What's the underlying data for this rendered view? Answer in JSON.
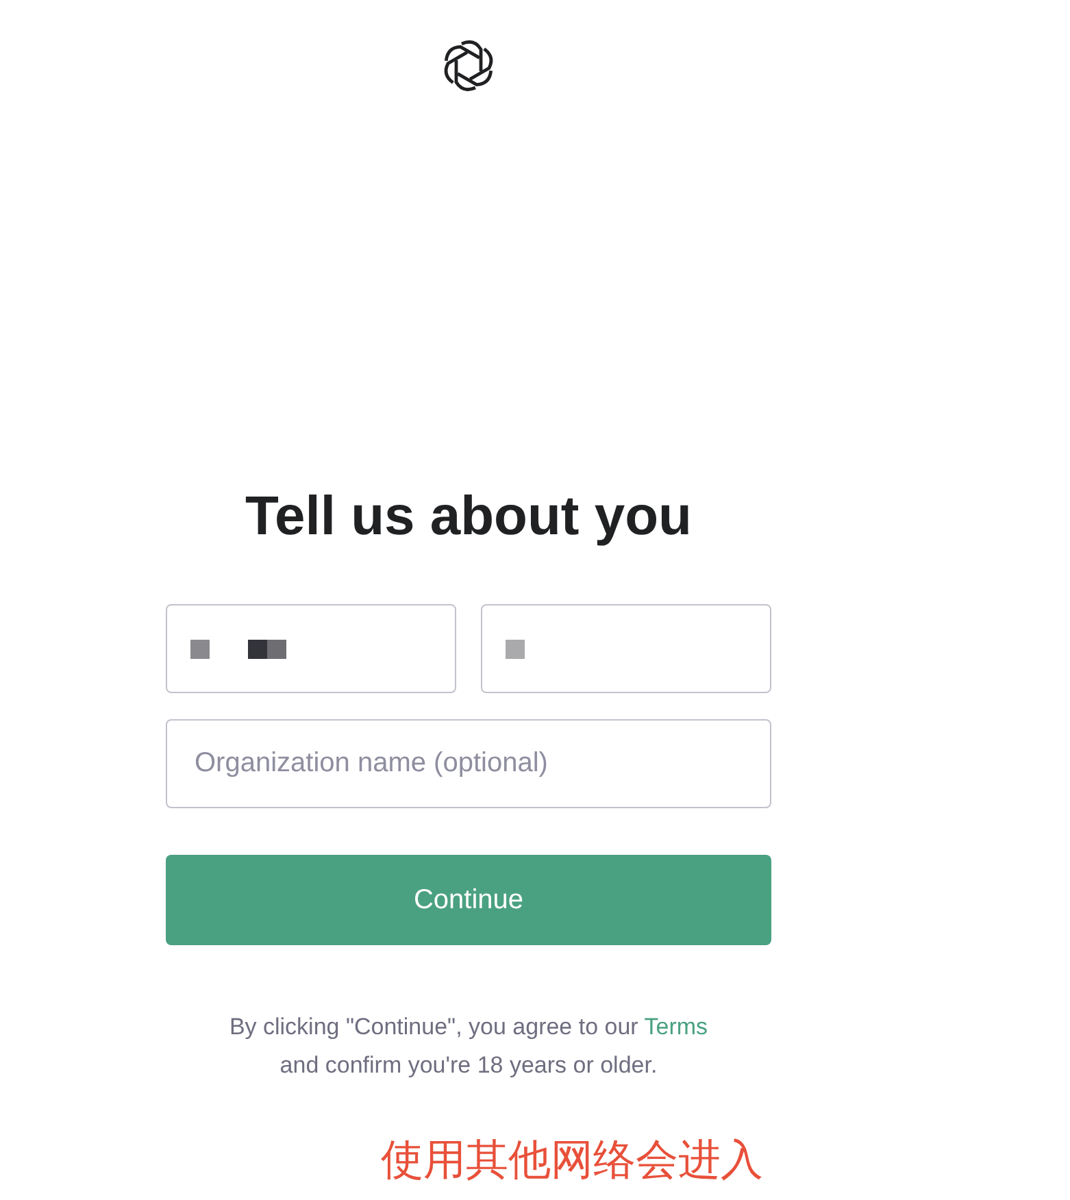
{
  "heading": "Tell us about you",
  "fields": [
    {
      "kind": "redacted_long"
    },
    {
      "kind": "redacted_short"
    },
    {
      "kind": "text",
      "placeholder": "Organization name (optional)"
    }
  ],
  "button": "Continue",
  "legal": {
    "text": "By clicking \"Continue\", you agree to our",
    "link": "Terms",
    "rest": "and confirm you're 18 years or older."
  },
  "caption": "使用其他网络会进入"
}
